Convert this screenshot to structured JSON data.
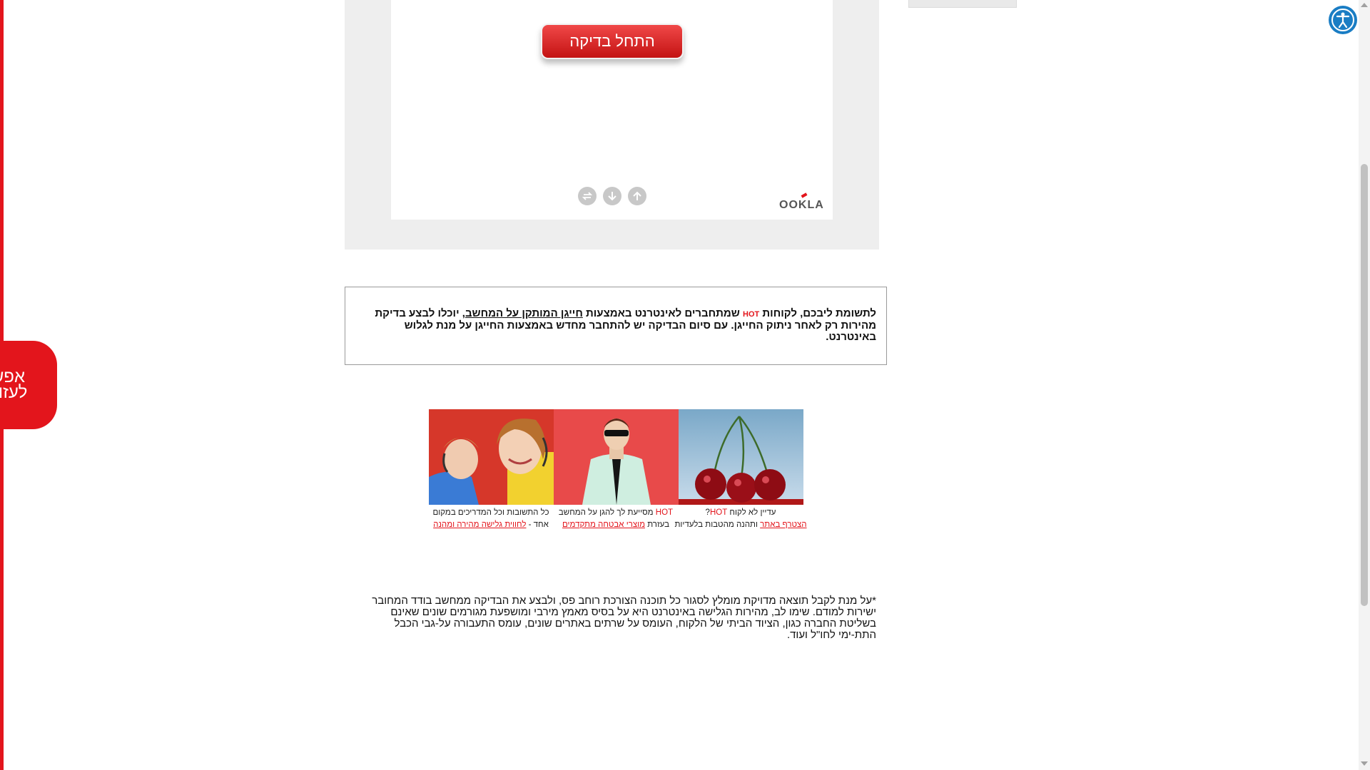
{
  "help_tab": {
    "line1": "אפשר",
    "line2": "לעזור?"
  },
  "accessibility": {
    "icon": "accessibility-icon"
  },
  "speedtest": {
    "start_label": "התחל בדיקה",
    "controls": [
      "upload-icon",
      "download-icon",
      "ping-icon"
    ],
    "logo": "OOKLA"
  },
  "info": {
    "part1": "לתשומת ליבכם, לקוחות ",
    "hot": "HOT",
    "part2": " שמתחברים לאינטרנט באמצעות ",
    "link": "חייגן המותקן על המחשב",
    "part3": ", יוכלו לבצע בדיקת מהירות רק לאחר ניתוק החייגן. עם סיום הבדיקה יש להתחבר מחדש באמצעות החייגן על מנת לגלוש באינטרנט."
  },
  "promos": [
    {
      "pre": "עדיין לא לקוח ",
      "red": "HOT",
      "post": "?",
      "line2_link": "הצטרף באתר",
      "line2_post": " ותהנה מהטבות בלעדיות"
    },
    {
      "red": "HOT",
      "post": " מסייעת לך להגן על המחשב",
      "line2_pre": "בעזרת ",
      "line2_link": "מוצרי אבטחה מתקדמים"
    },
    {
      "line1": "כל התשובות וכל המדריכים במקום",
      "line2_pre": "אחד - ",
      "line2_link": "לחווית גלישה מהירה ומהנה"
    }
  ],
  "disclaimer": "*על מנת לקבל תוצאה מדויקת מומלץ לסגור כל תוכנה הצורכת רוחב פס, ולבצע את הבדיקה ממחשב בודד המחובר ישירות למודם. שימו לב, מהירות הגלישה באינטרנט היא על בסיס מאמץ מירבי ומושפעת מגורמים שונים שאינם בשליטת החברה כגון, הציוד הביתי של הלקוח, העומס על שרתים באתרים שונים, עומס התעבורה על-גבי הכבל התת-ימי לחו\"ל ועוד.",
  "colors": {
    "brand_red": "#e3151c",
    "panel_gray": "#eeeeee",
    "access_blue": "#1a7dc4"
  }
}
